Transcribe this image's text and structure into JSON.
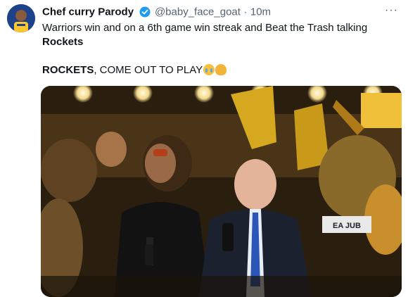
{
  "tweet": {
    "author_name": "Chef curry Parody",
    "handle": "@baby_face_goat",
    "separator": "·",
    "time": "10m",
    "more_label": "···",
    "line1": "Warriors win and on a 6th game win streak and Beat the Trash talking",
    "line2": "Rockets",
    "line3_bold": "ROCKETS",
    "line3_rest": ", COME OUT TO PLAY"
  },
  "media": {
    "caption_text": "EA JUB"
  },
  "colors": {
    "verified": "#1d9bf0",
    "secondary_text": "#536471",
    "warriors_gold": "#ffc72c"
  }
}
